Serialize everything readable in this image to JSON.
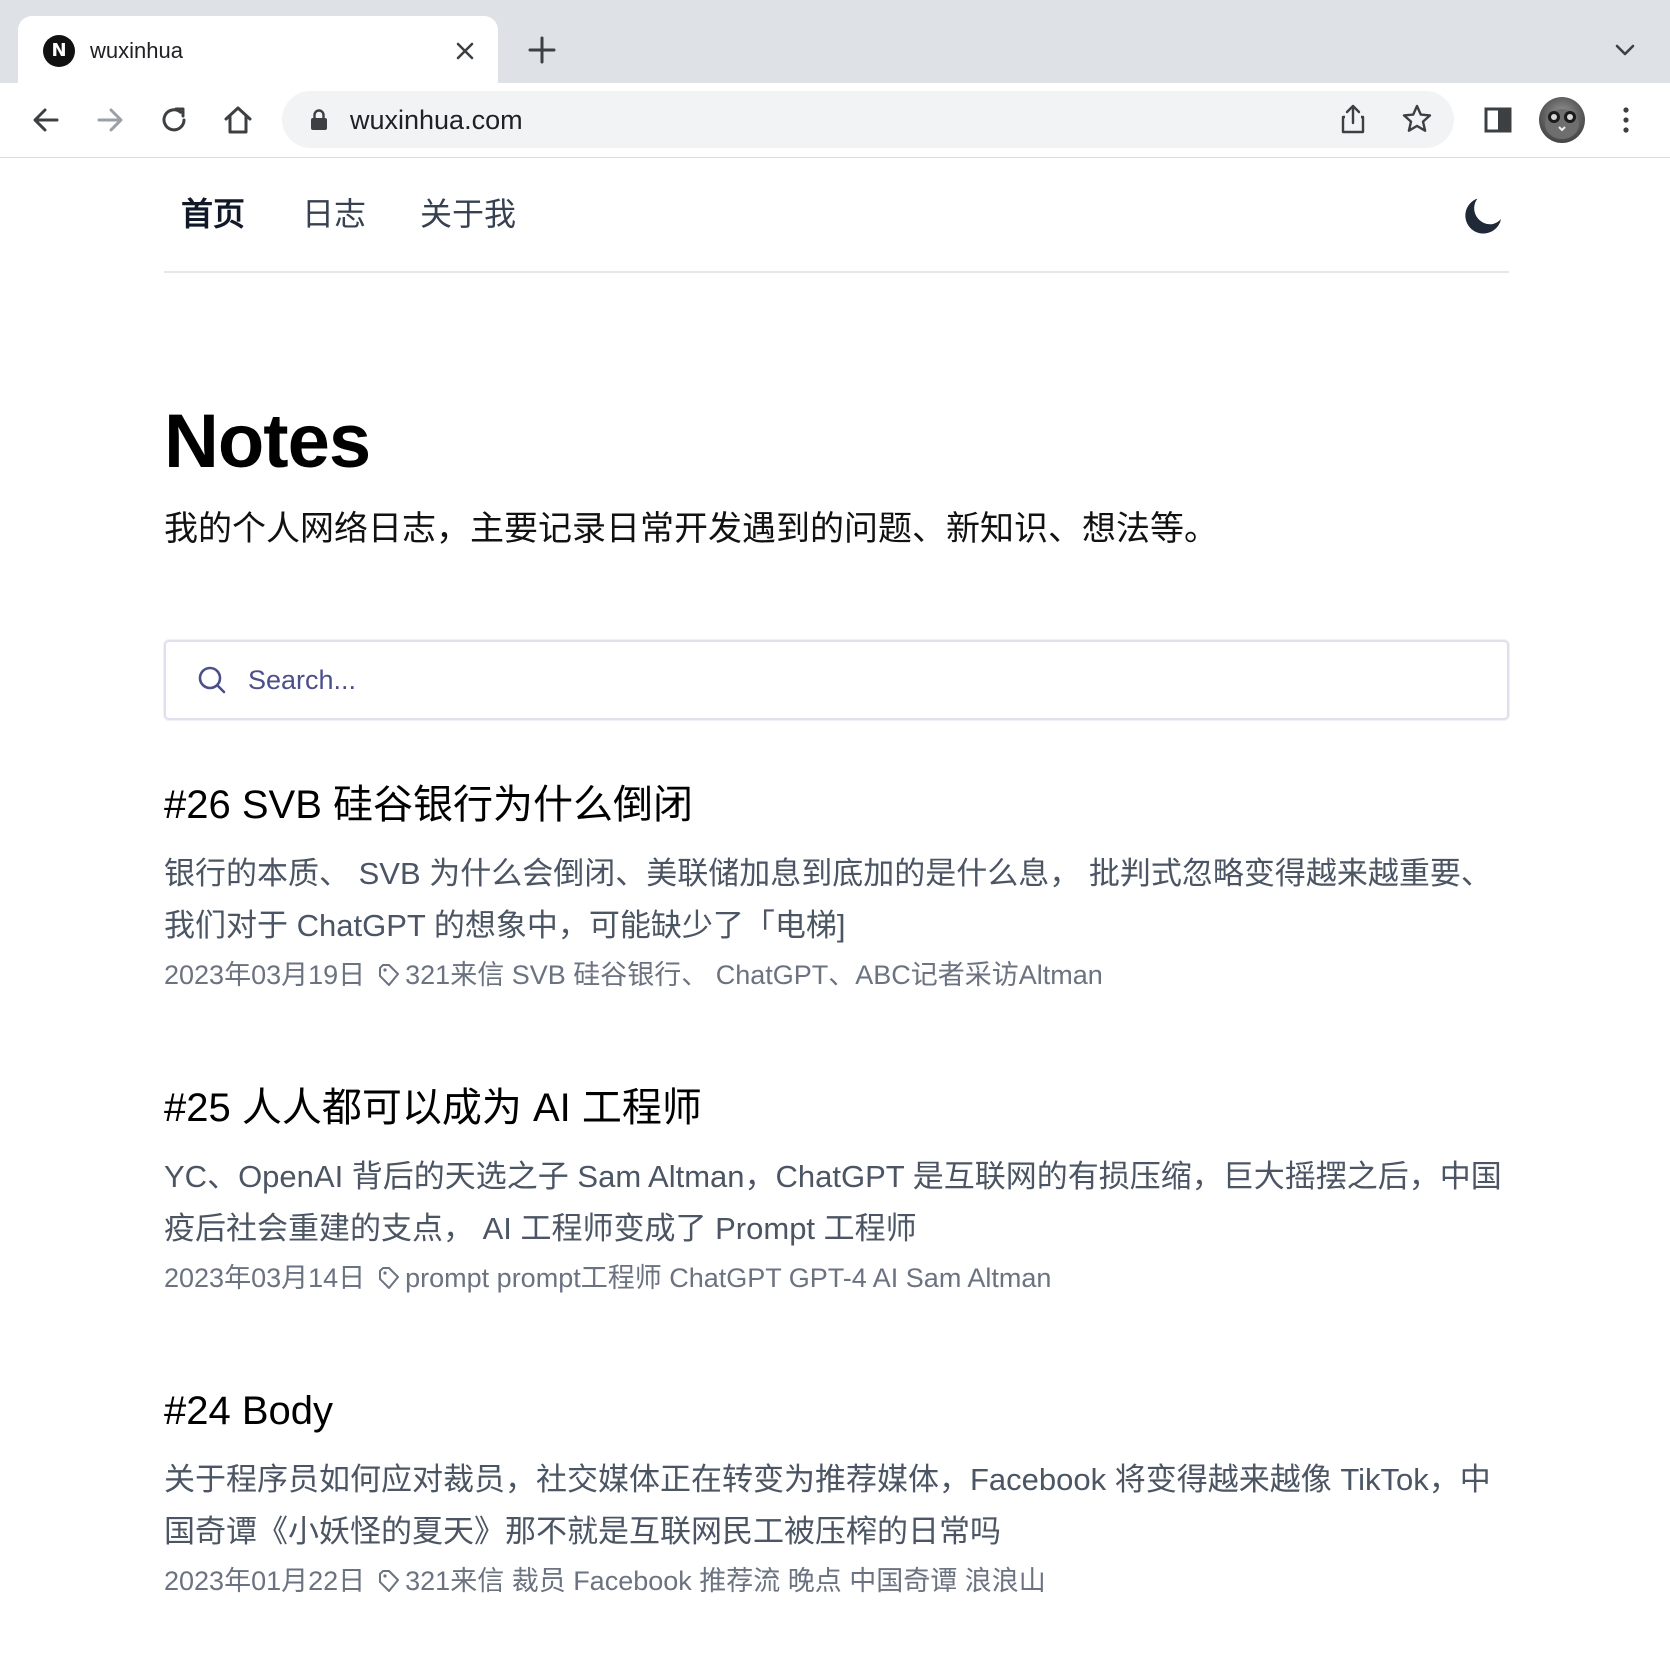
{
  "browser": {
    "tab_title": "wuxinhua",
    "tab_favicon_letter": "N",
    "url": "wuxinhua.com"
  },
  "nav": {
    "items": [
      {
        "label": "首页",
        "active": true
      },
      {
        "label": "日志",
        "active": false
      },
      {
        "label": "关于我",
        "active": false
      }
    ]
  },
  "page": {
    "title": "Notes",
    "description": "我的个人网络日志，主要记录日常开发遇到的问题、新知识、想法等。"
  },
  "search": {
    "placeholder": "Search...",
    "value": ""
  },
  "posts": [
    {
      "title": "#26 SVB 硅谷银行为什么倒闭",
      "summary": "银行的本质、 SVB 为什么会倒闭、美联储加息到底加的是什么息， 批判式忽略变得越来越重要、我们对于 ChatGPT 的想象中，可能缺少了「电梯]",
      "date": "2023年03月19日",
      "tags": "321来信 SVB 硅谷银行、 ChatGPT、ABC记者采访Altman"
    },
    {
      "title": "#25 人人都可以成为 AI 工程师",
      "summary": "YC、OpenAI 背后的天选之子 Sam Altman，ChatGPT 是互联网的有损压缩，巨大摇摆之后，中国疫后社会重建的支点， AI 工程师变成了 Prompt 工程师",
      "date": "2023年03月14日",
      "tags": "prompt prompt工程师 ChatGPT GPT-4 AI Sam Altman"
    },
    {
      "title": "#24 Body",
      "summary": "关于程序员如何应对裁员，社交媒体正在转变为推荐媒体，Facebook 将变得越来越像 TikTok，中国奇谭《小妖怪的夏天》那不就是互联网民工被压榨的日常吗",
      "date": "2023年01月22日",
      "tags": "321来信 裁员 Facebook 推荐流 晚点 中国奇谭 浪浪山"
    }
  ]
}
